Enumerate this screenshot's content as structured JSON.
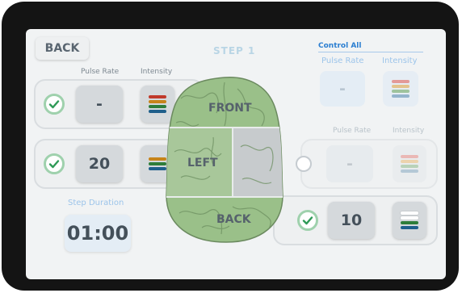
{
  "back_button": "BACK",
  "step_title": "STEP 1",
  "headers": {
    "pulse_rate": "Pulse Rate",
    "intensity": "Intensity"
  },
  "control_all": {
    "title": "Control All",
    "pulse_rate_label": "Pulse Rate",
    "intensity_label": "Intensity",
    "pulse_value": "-"
  },
  "regions": {
    "front": {
      "label": "FRONT",
      "checked": true,
      "pulse_rate": "-"
    },
    "left": {
      "label": "LEFT",
      "checked": true,
      "pulse_rate": "20"
    },
    "right": {
      "pulse_rate": "-",
      "pulse_rate_label": "Pulse Rate",
      "intensity_label": "Intensity"
    },
    "back": {
      "label": "BACK",
      "checked": true,
      "pulse_rate": "10"
    }
  },
  "step_duration": {
    "label": "Step Duration",
    "value": "01:00"
  },
  "colors": {
    "bar_red": "#c0392b",
    "bar_orange": "#c7841a",
    "bar_green": "#2e7d3a",
    "bar_blue": "#1f5f8b",
    "brain_green": "#9ac089",
    "check_green": "#2f9a57"
  }
}
